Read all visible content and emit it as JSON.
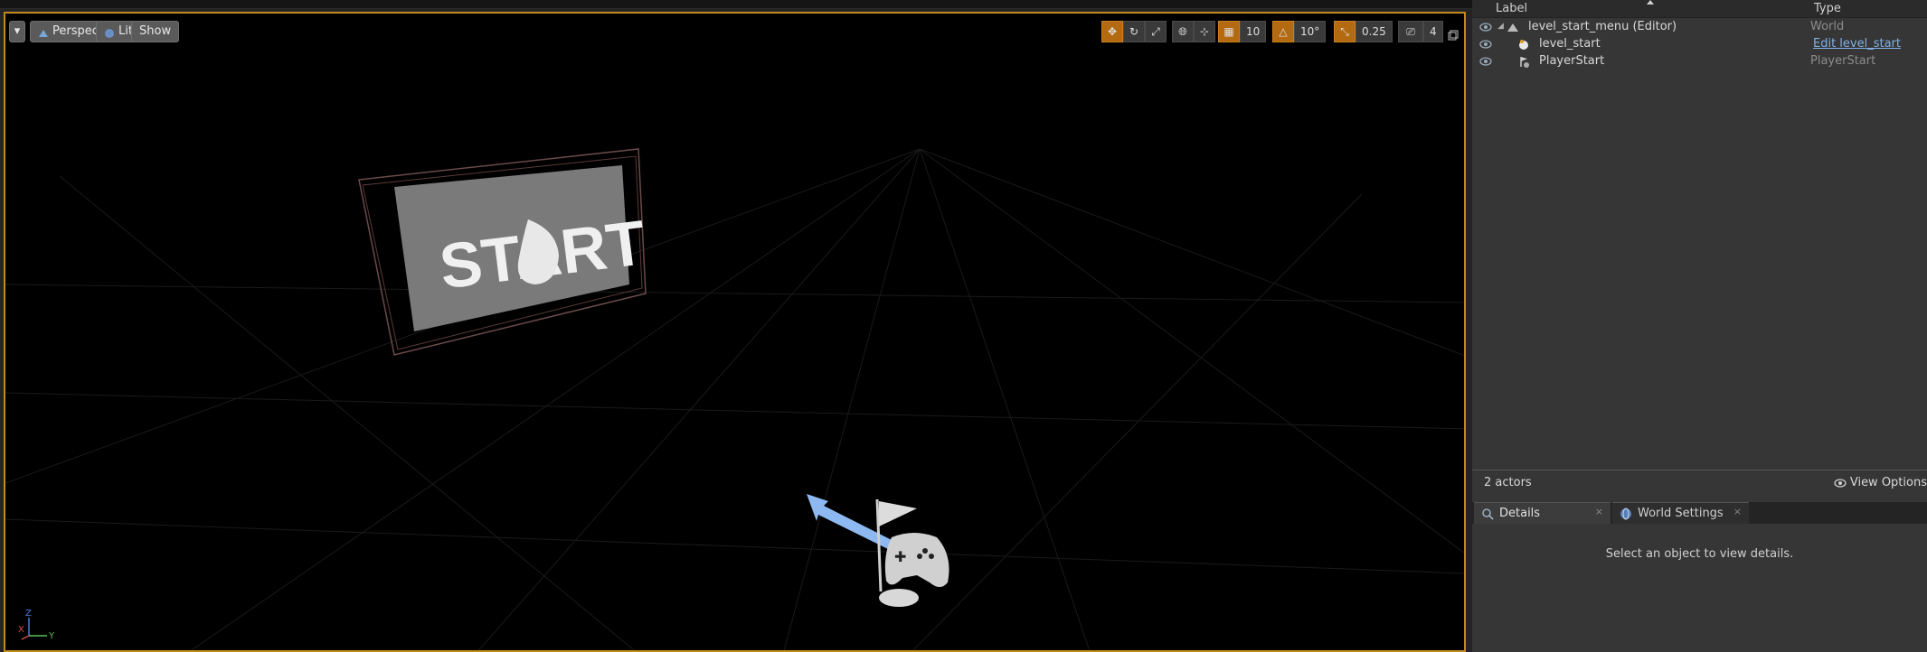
{
  "viewport": {
    "menu_label": "▾",
    "perspective_label": "Perspective",
    "lit_label": "Lit",
    "show_label": "Show",
    "grid_snap": "10",
    "rotation_snap": "10°",
    "scale_snap": "0.25",
    "camera_speed": "4",
    "scene_text": "START",
    "gizmo_x": "X",
    "gizmo_y": "Y",
    "gizmo_z": "Z"
  },
  "outliner": {
    "col_label": "Label",
    "col_type": "Type",
    "rows": [
      {
        "name": "level_start_menu (Editor)",
        "type": "World",
        "icon": "world-icon"
      },
      {
        "name": "level_start",
        "type": "Edit level_start",
        "icon": "level-icon"
      },
      {
        "name": "PlayerStart",
        "type": "PlayerStart",
        "icon": "player-start-icon"
      }
    ],
    "actor_count": "2 actors",
    "view_options": "View Options"
  },
  "panels": {
    "details_tab": "Details",
    "world_settings_tab": "World Settings",
    "close_glyph": "×",
    "empty_message": "Select an object to view details."
  },
  "colors": {
    "accent_orange": "#c08a1c",
    "link_blue": "#7fb1e6",
    "panel_bg": "#363636"
  }
}
